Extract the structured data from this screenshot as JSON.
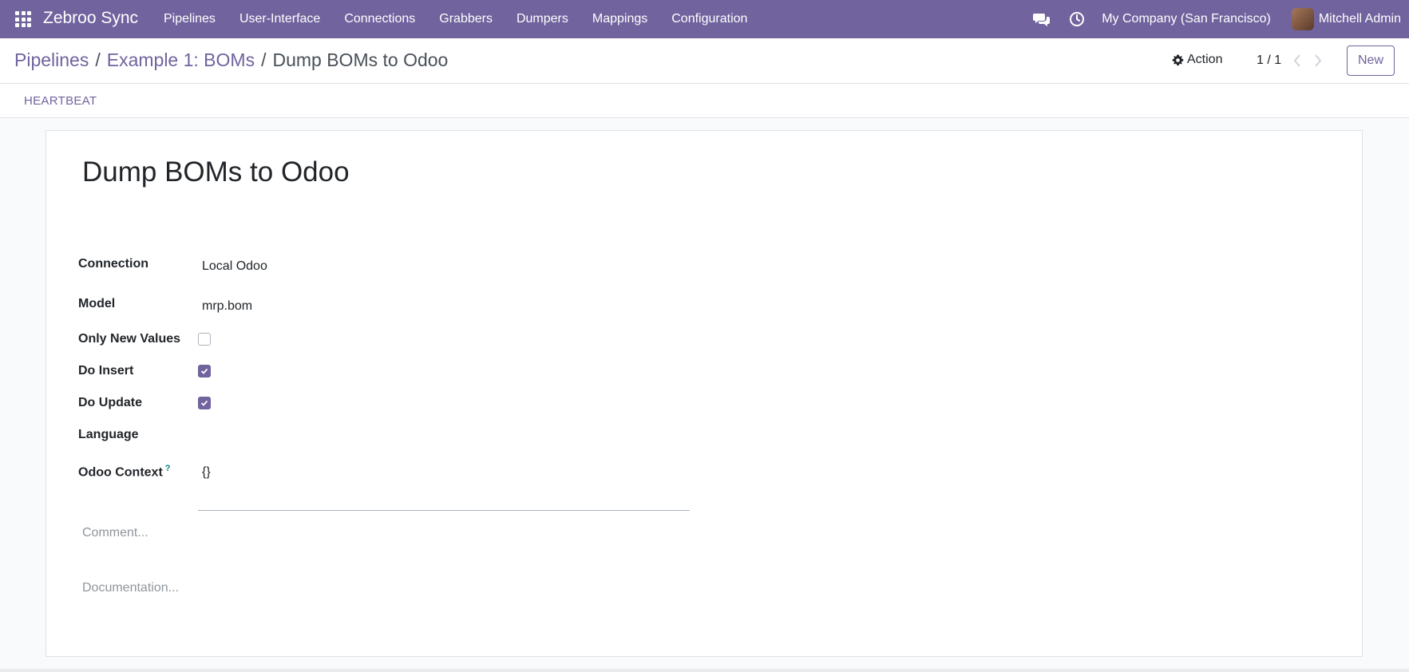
{
  "navbar": {
    "brand": "Zebroo Sync",
    "menu": [
      "Pipelines",
      "User-Interface",
      "Connections",
      "Grabbers",
      "Dumpers",
      "Mappings",
      "Configuration"
    ],
    "company": "My Company (San Francisco)",
    "user": "Mitchell Admin",
    "icons": [
      "apps-grid-icon",
      "chat-icon",
      "clock-icon"
    ],
    "accent_color": "#71639e"
  },
  "breadcrumb": {
    "items": [
      "Pipelines",
      "Example 1: BOMs"
    ],
    "current": "Dump BOMs to Odoo",
    "separator": "/"
  },
  "control": {
    "action_label": "Action",
    "pager": "1 / 1",
    "new_label": "New"
  },
  "statusbar": {
    "heartbeat_label": "HEARTBEAT"
  },
  "form": {
    "title": "Dump BOMs to Odoo",
    "fields": {
      "connection": {
        "label": "Connection",
        "value": "Local Odoo"
      },
      "model": {
        "label": "Model",
        "value": "mrp.bom"
      },
      "only_new_values": {
        "label": "Only New Values",
        "checked": false
      },
      "do_insert": {
        "label": "Do Insert",
        "checked": true
      },
      "do_update": {
        "label": "Do Update",
        "checked": true
      },
      "language": {
        "label": "Language",
        "value": ""
      },
      "odoo_context": {
        "label": "Odoo Context",
        "help": "?",
        "value": "{}"
      }
    },
    "comment_placeholder": "Comment...",
    "documentation_placeholder": "Documentation..."
  }
}
